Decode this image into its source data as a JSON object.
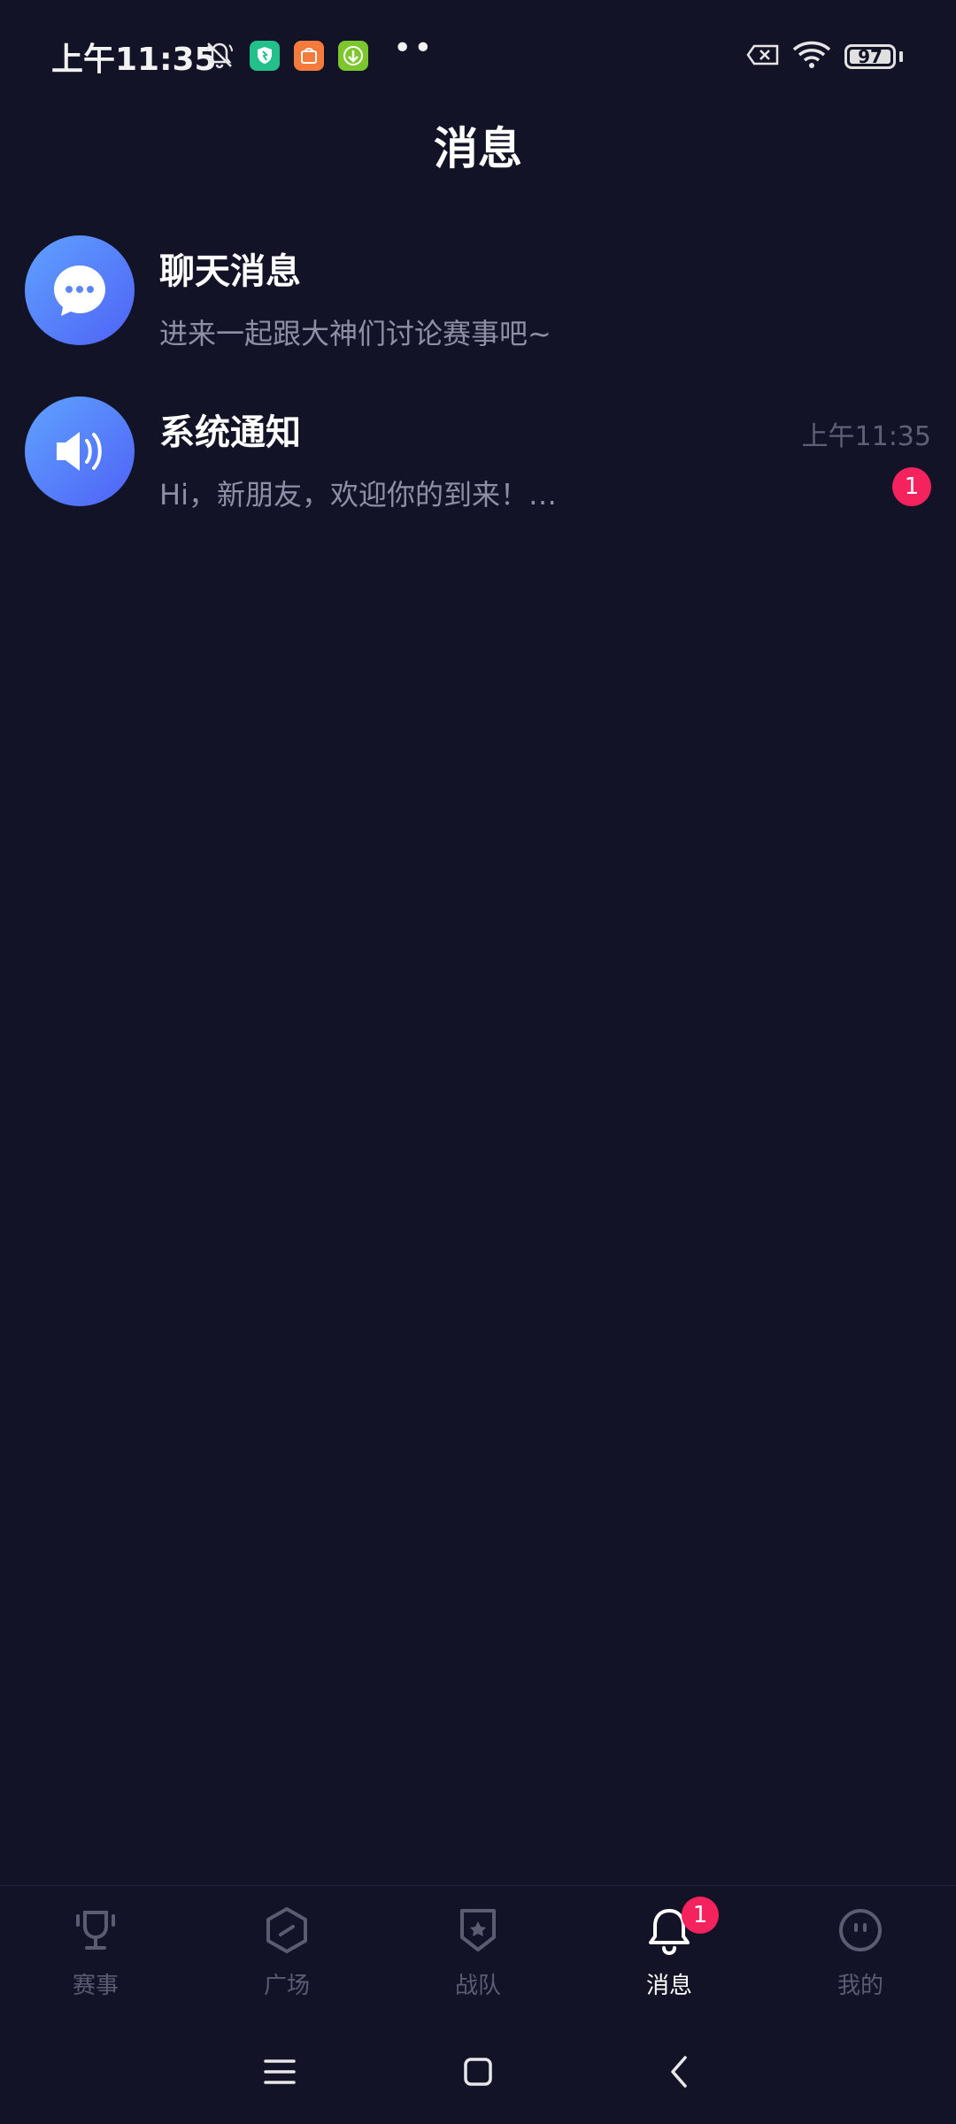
{
  "status_bar": {
    "time": "上午11:35",
    "battery": "97",
    "battery_level": 0.97,
    "icons": [
      "mute-bell-icon",
      "shield-app-icon",
      "mi-store-app-icon",
      "download-app-icon",
      "more-dots-icon",
      "no-sim-icon",
      "wifi-icon",
      "battery-icon"
    ],
    "more": "••"
  },
  "header": {
    "title": "消息"
  },
  "messages": [
    {
      "title": "聊天消息",
      "preview": "进来一起跟大神们讨论赛事吧~",
      "icon": "chat-bubble-icon"
    },
    {
      "title": "系统通知",
      "preview": "Hi，新朋友，欢迎你的到来！…",
      "time": "上午11:35",
      "unread": "1",
      "icon": "speaker-icon"
    }
  ],
  "bottom_nav": {
    "items": [
      {
        "label": "赛事",
        "icon": "trophy-icon"
      },
      {
        "label": "广场",
        "icon": "hexagon-icon"
      },
      {
        "label": "战队",
        "icon": "shield-star-icon"
      },
      {
        "label": "消息",
        "icon": "bell-icon",
        "badge": "1",
        "active": true
      },
      {
        "label": "我的",
        "icon": "face-icon"
      }
    ]
  },
  "colors": {
    "background": "#131327",
    "accent_gradient_start": "#5fa2ff",
    "accent_gradient_end": "#4f62f6",
    "badge": "#f4235d",
    "muted_text": "#8e8fa7",
    "inactive_nav": "#5b5c72"
  }
}
